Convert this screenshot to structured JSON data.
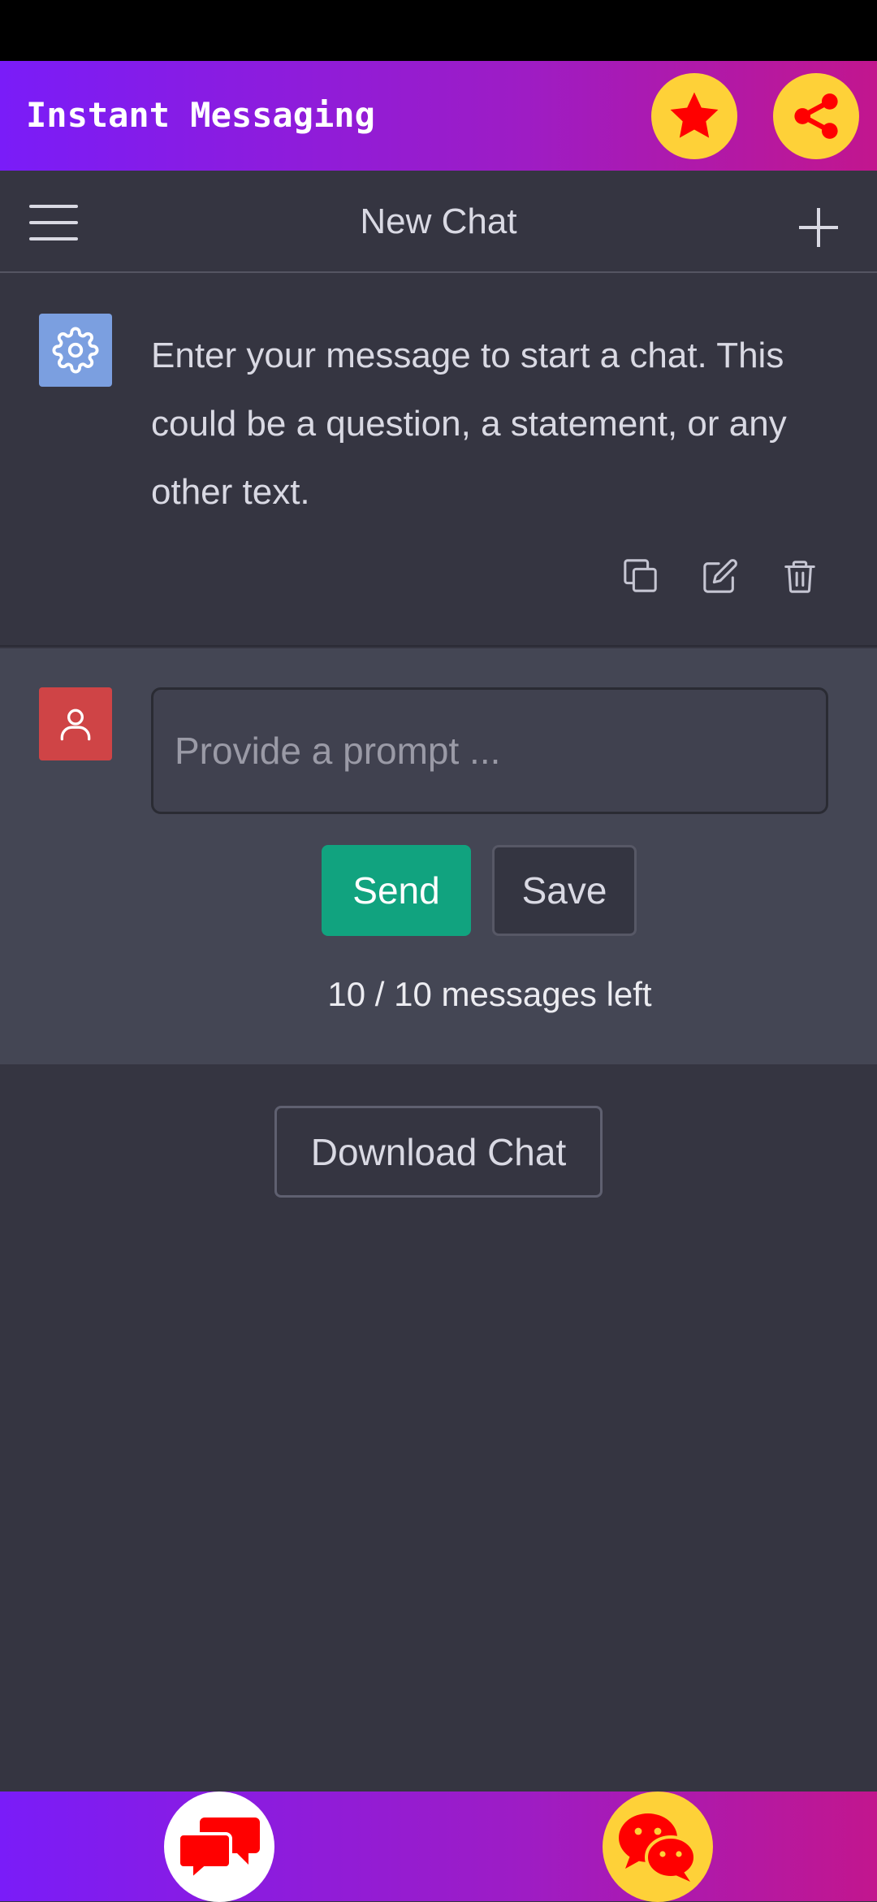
{
  "app": {
    "title": "Instant Messaging",
    "header_gradient": [
      "#7a1cf8",
      "#c2168e"
    ],
    "action_icons": [
      "star-icon",
      "share-icon"
    ]
  },
  "chat_header": {
    "title": "New Chat",
    "menu_icon": "hamburger-menu-icon",
    "new_chat_icon": "plus-icon"
  },
  "system_message": {
    "text": "Enter your message to start a chat. This could be a question, a statement, or any other text.",
    "avatar_icon": "gear-icon",
    "avatar_color": "#7b9fe0",
    "actions": [
      "copy-icon",
      "edit-icon",
      "trash-icon"
    ]
  },
  "prompt": {
    "placeholder": "Provide a prompt ...",
    "value": "",
    "avatar_icon": "user-icon",
    "avatar_color": "#cf4446",
    "send_label": "Send",
    "send_color": "#11a37f",
    "save_label": "Save",
    "messages_left": "10 / 10 messages left"
  },
  "download": {
    "label": "Download Chat"
  },
  "bottom_nav": {
    "items": [
      "chat-bubbles-icon",
      "wechat-icon"
    ]
  }
}
